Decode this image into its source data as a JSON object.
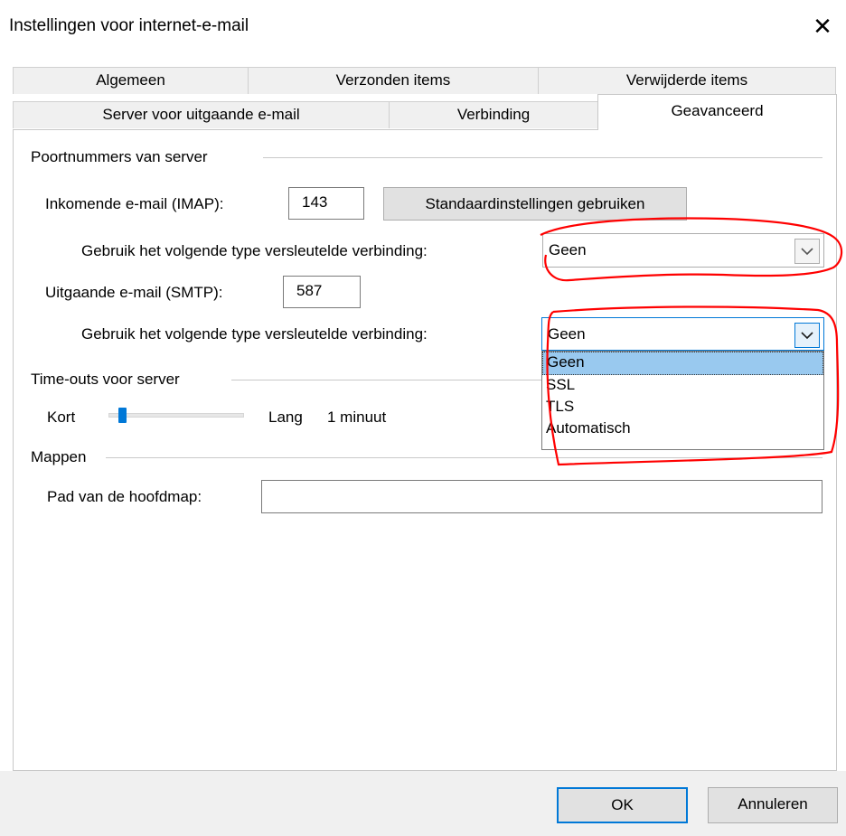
{
  "window": {
    "title": "Instellingen voor internet-e-mail",
    "close_glyph": "✕"
  },
  "tabs_row1": [
    {
      "label": "Algemeen"
    },
    {
      "label": "Verzonden items"
    },
    {
      "label": "Verwijderde items"
    }
  ],
  "tabs_row2": [
    {
      "label": "Server voor uitgaande e-mail"
    },
    {
      "label": "Verbinding"
    },
    {
      "label": "Geavanceerd",
      "active": true
    }
  ],
  "ports": {
    "group_label": "Poortnummers van server",
    "incoming_label": "Inkomende e-mail (IMAP):",
    "incoming_value": "143",
    "defaults_button": "Standaardinstellingen gebruiken",
    "incoming_enc_label": "Gebruik het volgende type versleutelde verbinding:",
    "incoming_enc_value": "Geen",
    "outgoing_label": "Uitgaande e-mail (SMTP):",
    "outgoing_value": "587",
    "outgoing_enc_label": "Gebruik het volgende type versleutelde verbinding:",
    "outgoing_enc_value": "Geen",
    "outgoing_enc_options": [
      "Geen",
      "SSL",
      "TLS",
      "Automatisch"
    ],
    "outgoing_enc_selected_index": 0
  },
  "timeouts": {
    "group_label": "Time-outs voor server",
    "short_label": "Kort",
    "long_label": "Lang",
    "value_text": "1 minuut",
    "slider_fraction": 0.1
  },
  "folders": {
    "group_label": "Mappen",
    "root_path_label": "Pad van de hoofdmap:",
    "root_path_value": ""
  },
  "footer": {
    "ok_label": "OK",
    "cancel_label": "Annuleren"
  },
  "colors": {
    "accent": "#0078d7",
    "annotation": "#ff0000",
    "selection": "#99c9ef"
  },
  "icons": {
    "close": "close-icon",
    "dropdown": "chevron-down-icon"
  }
}
